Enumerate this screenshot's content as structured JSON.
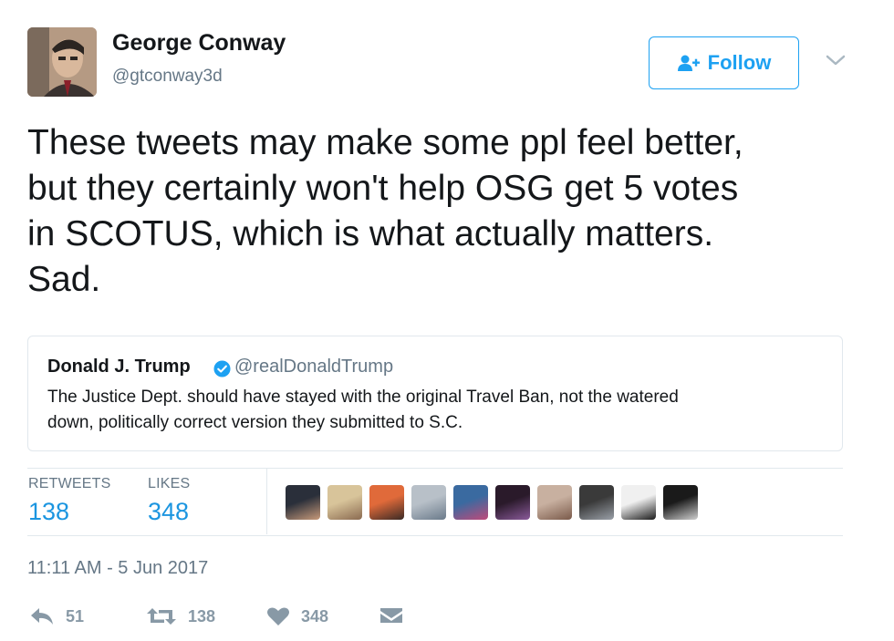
{
  "author": {
    "name": "George Conway",
    "handle": "@gtconway3d",
    "avatar_icon": "user-avatar-portrait"
  },
  "follow_button": {
    "label": "Follow",
    "icon": "add-user-icon",
    "color": "#1da1f2"
  },
  "tweet": {
    "lines": [
      "These tweets may make some ppl feel better,",
      "but they certainly won't help OSG get 5 votes",
      "in SCOTUS, which is what actually matters.",
      "Sad."
    ]
  },
  "quoted_tweet": {
    "name": "Donald J. Trump",
    "verified_icon": "verified-badge-icon",
    "handle": "@realDonaldTrump",
    "lines": [
      "The Justice Dept. should have stayed with the original Travel Ban, not the watered",
      "down, politically correct version they submitted to S.C."
    ]
  },
  "stats": {
    "retweets_label": "RETWEETS",
    "retweets_value": "138",
    "likes_label": "LIKES",
    "likes_value": "348",
    "accent_color": "#1b95e0"
  },
  "likers": [
    {
      "name": "liker-avatar-1",
      "colors": [
        "#2a2f3a",
        "#c89a7a"
      ]
    },
    {
      "name": "liker-avatar-2",
      "colors": [
        "#d8c49a",
        "#8a6a50"
      ]
    },
    {
      "name": "liker-avatar-3",
      "colors": [
        "#e06a3a",
        "#3a2a25"
      ]
    },
    {
      "name": "liker-avatar-4",
      "colors": [
        "#b8c0c8",
        "#6a7a8a"
      ]
    },
    {
      "name": "liker-avatar-5",
      "colors": [
        "#3a6aa0",
        "#c04a7a"
      ]
    },
    {
      "name": "liker-avatar-6",
      "colors": [
        "#2a1a2a",
        "#8a5a9a"
      ]
    },
    {
      "name": "liker-avatar-7",
      "colors": [
        "#c8b0a0",
        "#7a5a4a"
      ]
    },
    {
      "name": "liker-avatar-8",
      "colors": [
        "#3a3a3a",
        "#9aa0a8"
      ]
    },
    {
      "name": "liker-avatar-9",
      "colors": [
        "#f0f0f0",
        "#1a1a1a"
      ]
    },
    {
      "name": "liker-avatar-10",
      "colors": [
        "#1a1a1a",
        "#d0d0d0"
      ]
    }
  ],
  "timestamp": "11:11 AM - 5 Jun 2017",
  "actions": {
    "reply_icon": "reply-icon",
    "reply_count": "51",
    "retweet_icon": "retweet-icon",
    "retweet_count": "138",
    "like_icon": "heart-icon",
    "like_count": "348",
    "dm_icon": "direct-message-icon",
    "icon_color": "#8899a6"
  },
  "more_menu_icon": "chevron-down-icon"
}
